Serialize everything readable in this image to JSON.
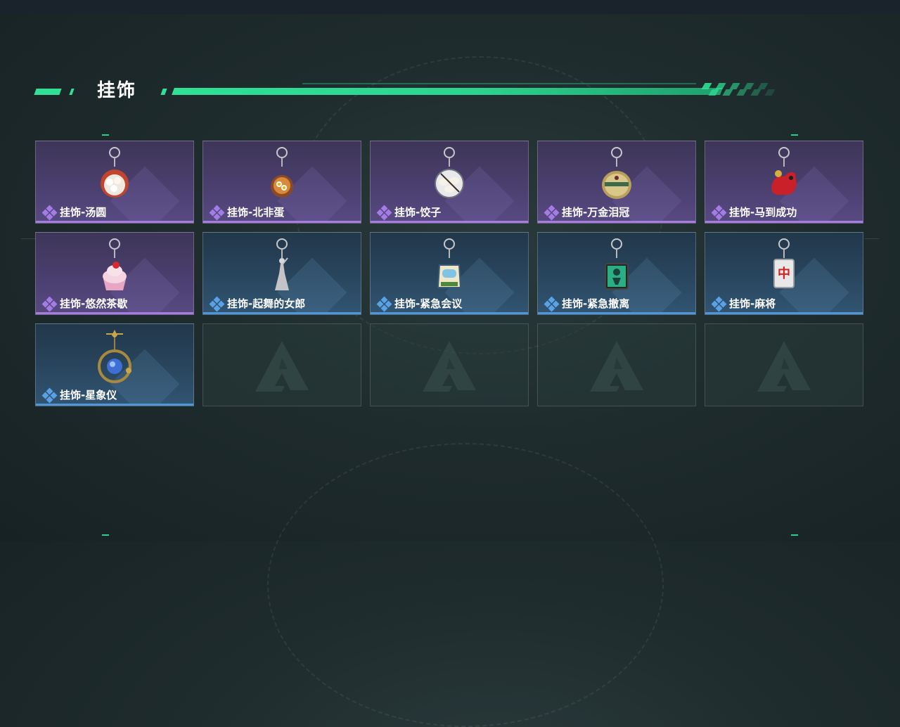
{
  "section": {
    "title": "挂饰"
  },
  "colors": {
    "accent": "#2fe095",
    "epic": "#a77be0",
    "rare": "#4f97db"
  },
  "items": [
    {
      "name": "挂饰-汤圆",
      "rarity": "epic",
      "icon": "tangyuan-charm-icon"
    },
    {
      "name": "挂饰-北非蛋",
      "rarity": "epic",
      "icon": "shakshuka-charm-icon"
    },
    {
      "name": "挂饰-饺子",
      "rarity": "epic",
      "icon": "dumpling-charm-icon"
    },
    {
      "name": "挂饰-万金泪冠",
      "rarity": "epic",
      "icon": "crown-charm-icon"
    },
    {
      "name": "挂饰-马到成功",
      "rarity": "epic",
      "icon": "red-horse-charm-icon"
    },
    {
      "name": "挂饰-悠然茶歇",
      "rarity": "epic",
      "icon": "cupcake-charm-icon"
    },
    {
      "name": "挂饰-起舞的女郎",
      "rarity": "rare",
      "icon": "dancer-charm-icon"
    },
    {
      "name": "挂饰-紧急会议",
      "rarity": "rare",
      "icon": "meeting-charm-icon"
    },
    {
      "name": "挂饰-紧急撤离",
      "rarity": "rare",
      "icon": "evacuation-charm-icon"
    },
    {
      "name": "挂饰-麻将",
      "rarity": "rare",
      "icon": "mahjong-charm-icon"
    },
    {
      "name": "挂饰-星象仪",
      "rarity": "rare",
      "icon": "orrery-charm-icon"
    }
  ],
  "mahjong_glyph": "中",
  "empty_slots": 4
}
